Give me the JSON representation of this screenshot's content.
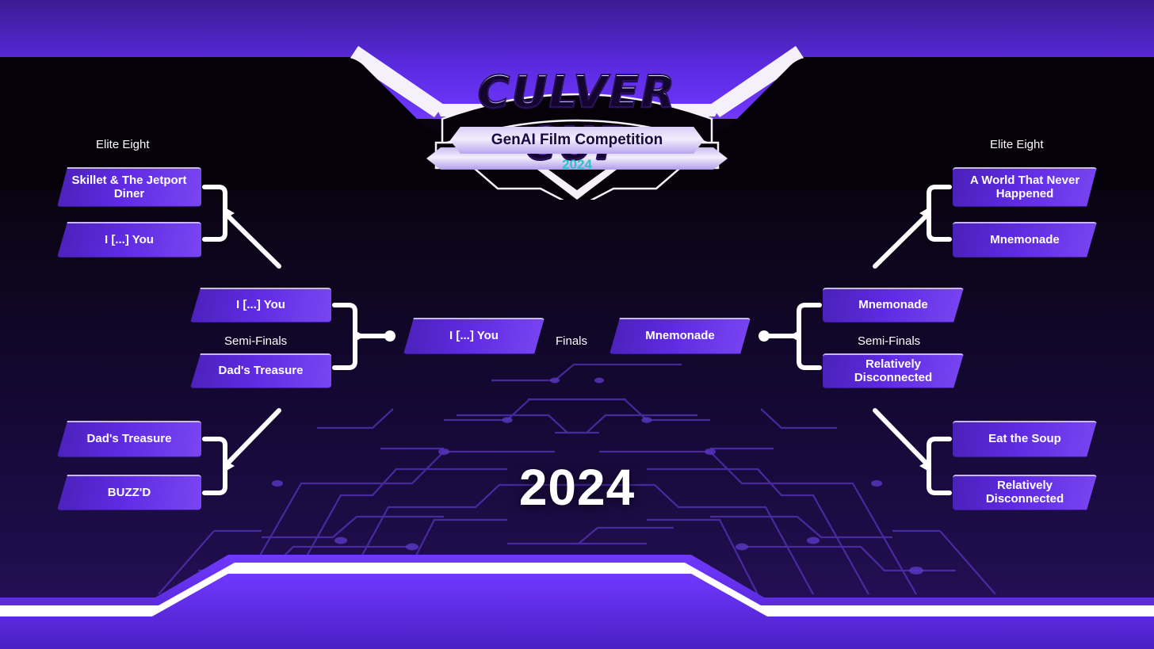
{
  "logo": {
    "title": "CULVER CUP",
    "subtitle": "GenAI Film Competition",
    "year": "2024"
  },
  "center": {
    "year": "2024"
  },
  "labels": {
    "elite_eight_left": "Elite Eight",
    "elite_eight_right": "Elite Eight",
    "semi_finals_left": "Semi-Finals",
    "semi_finals_right": "Semi-Finals",
    "finals": "Finals"
  },
  "colors": {
    "accent": "#6a35f5",
    "box_light": "#7a46f2",
    "box_dark": "#4a21b8",
    "banner": "#5a2ae0",
    "white": "#f4f1fb",
    "bg_dark": "#050108",
    "bg_purple": "#2a1160",
    "logo_teal": "#27c4c8",
    "circuit_trace": "#5b37c4"
  },
  "bracket": {
    "left": {
      "elite_eight": [
        {
          "name": "Skillet & The Jetport Diner"
        },
        {
          "name": "I [...] You"
        },
        {
          "name": "Dad's Treasure"
        },
        {
          "name": "BUZZ'D"
        }
      ],
      "semi_finals": [
        {
          "name": "I [...] You"
        },
        {
          "name": "Dad's Treasure"
        }
      ],
      "finals": {
        "name": "I [...] You"
      }
    },
    "right": {
      "elite_eight": [
        {
          "name": "A World That Never Happened"
        },
        {
          "name": "Mnemonade"
        },
        {
          "name": "Eat the Soup"
        },
        {
          "name": "Relatively Disconnected"
        }
      ],
      "semi_finals": [
        {
          "name": "Mnemonade"
        },
        {
          "name": "Relatively Disconnected"
        }
      ],
      "finals": {
        "name": "Mnemonade"
      }
    }
  }
}
